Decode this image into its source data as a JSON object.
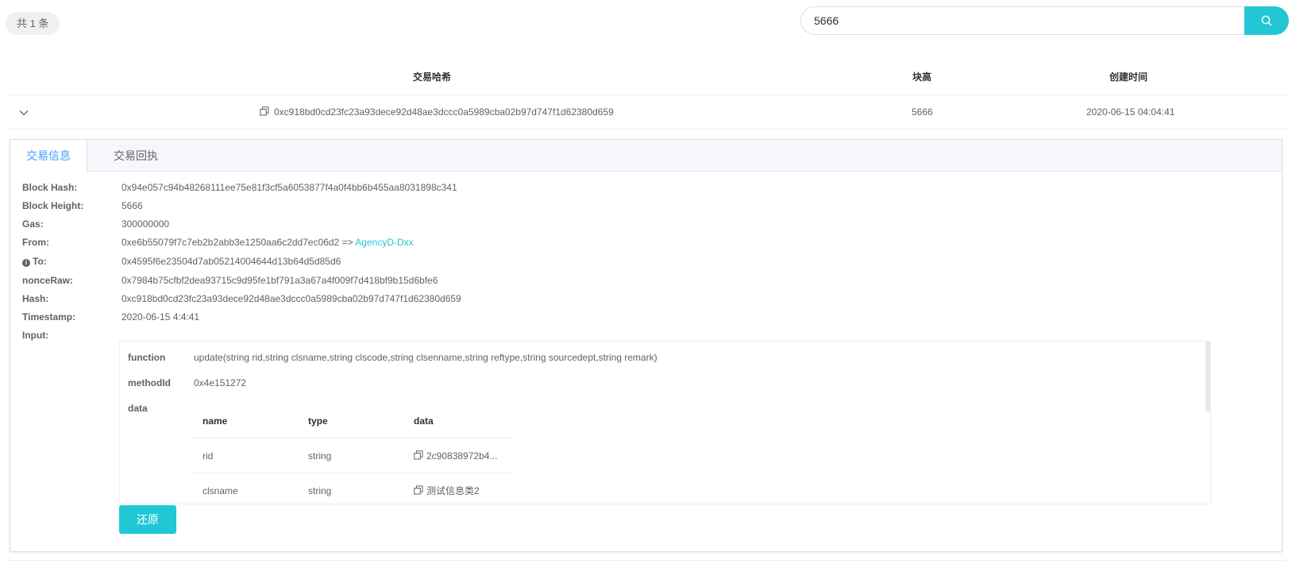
{
  "toolbar": {
    "count_label": "共 1 条",
    "search_value": "5666"
  },
  "table": {
    "headers": [
      "交易哈希",
      "块高",
      "创建时间"
    ],
    "row": {
      "hash": "0xc918bd0cd23fc23a93dece92d48ae3dccc0a5989cba02b97d747f1d62380d659",
      "height": "5666",
      "created": "2020-06-15 04:04:41"
    }
  },
  "detail": {
    "tabs": [
      "交易信息",
      "交易回执"
    ],
    "fields": [
      {
        "label": "Block Hash:",
        "value": "0x94e057c94b48268111ee75e81f3cf5a6053877f4a0f4bb6b455aa8031898c341"
      },
      {
        "label": "Block Height:",
        "value": "5666"
      },
      {
        "label": "Gas:",
        "value": "300000000"
      },
      {
        "label": "From:",
        "value": "0xe6b55079f7c7eb2b2abb3e1250aa6c2dd7ec06d2 =>",
        "link": "AgencyD-Dxx"
      },
      {
        "label": "To:",
        "value": "0x4595f6e23504d7ab05214004644d13b64d5d85d6"
      },
      {
        "label": "nonceRaw:",
        "value": "0x7984b75cfbf2dea93715c9d95fe1bf791a3a67a4f009f7d418bf9b15d6bfe6"
      },
      {
        "label": "Hash:",
        "value": "0xc918bd0cd23fc23a93dece92d48ae3dccc0a5989cba02b97d747f1d62380d659"
      },
      {
        "label": "Timestamp:",
        "value": "2020-06-15 4:4:41"
      },
      {
        "label": "Input:",
        "value": ""
      }
    ],
    "input": {
      "function_label": "function",
      "function_value": "update(string rid,string clsname,string clscode,string clsenname,string reftype,string sourcedept,string remark)",
      "methodid_label": "methodId",
      "methodid_value": "0x4e151272",
      "data_label": "data",
      "columns": [
        "name",
        "type",
        "data"
      ],
      "rows": [
        {
          "name": "rid",
          "type": "string",
          "data": "2c90838972b4..."
        },
        {
          "name": "clsname",
          "type": "string",
          "data": "测试信息类2"
        }
      ]
    },
    "restore_label": "还原"
  },
  "colors": {
    "accent": "#22c7d4",
    "tab_active": "#409eff"
  },
  "icons": {
    "search": "search-icon",
    "expand": "chevron-down-icon",
    "copy": "copy-icon",
    "info": "info-circle-icon"
  }
}
